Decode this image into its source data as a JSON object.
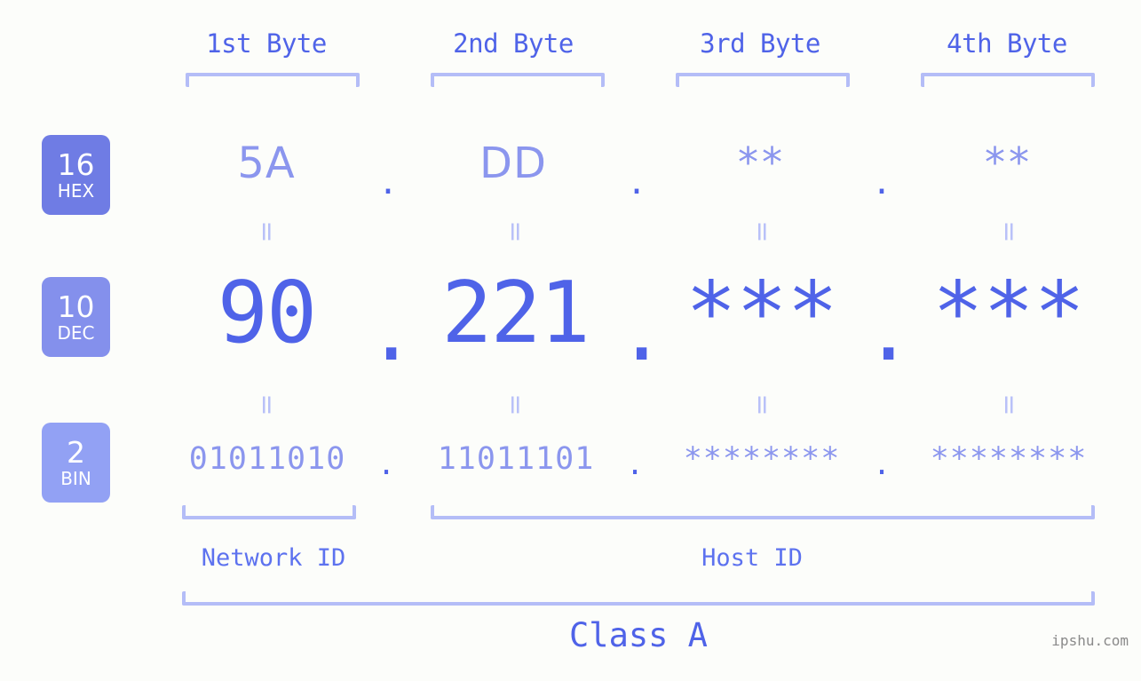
{
  "background_color": "#fcfdfa",
  "accent_color": "#4f63e8",
  "accent_light_color": "#8b96ee",
  "bracket_color": "#b4bdf7",
  "byte_headers": [
    {
      "label": "1st Byte"
    },
    {
      "label": "2nd Byte"
    },
    {
      "label": "3rd Byte"
    },
    {
      "label": "4th Byte"
    }
  ],
  "rows": [
    {
      "badge_number": "16",
      "badge_name": "HEX",
      "badge_color": "#6f7ce4",
      "values": [
        "5A",
        "DD",
        "**",
        "**"
      ],
      "separator": "."
    },
    {
      "badge_number": "10",
      "badge_name": "DEC",
      "badge_color": "#8490ec",
      "values": [
        "90",
        "221",
        "***",
        "***"
      ],
      "separator": "."
    },
    {
      "badge_number": "2",
      "badge_name": "BIN",
      "badge_color": "#92a1f4",
      "values": [
        "01011010",
        "11011101",
        "********",
        "********"
      ],
      "separator": "."
    }
  ],
  "equality_mark": "=",
  "sections": {
    "network_id": "Network ID",
    "host_id": "Host ID",
    "class": "Class A"
  },
  "watermark": "ipshu.com"
}
